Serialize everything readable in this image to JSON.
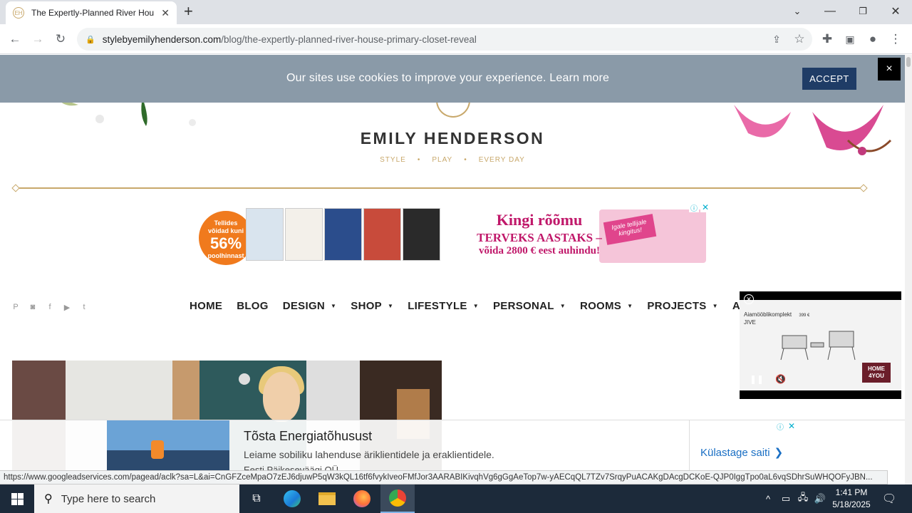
{
  "browser": {
    "tab_title": "The Expertly-Planned River Hou",
    "tab_favicon_icon": "emily-henderson-monogram-icon",
    "url_domain": "stylebyemilyhenderson.com",
    "url_path": "/blog/the-expertly-planned-river-house-primary-closet-reveal",
    "status_url": "https://www.googleadservices.com/pagead/aclk?sa=L&ai=CnGFZceMpaO7zEJ6djuwP5qW3kQL16tf6fvykIveoFMfJor3AARABIKivqhVg6gGgAeTop7w-yAECqQL7TZv7SrqyPuACAKgDAcgDCKoE-QJP0IggTpo0aL6vqSDhrSuWHQOFyJBN..."
  },
  "cookie_banner": {
    "message": "Our sites use cookies to improve your experience. Learn more",
    "accept_label": "ACCEPT",
    "close_label": "×"
  },
  "site": {
    "brand": "EMILY HENDERSON",
    "tagline": [
      "STYLE",
      "•",
      "PLAY",
      "•",
      "EVERY DAY"
    ],
    "social_icons": [
      "pinterest-icon",
      "instagram-icon",
      "facebook-icon",
      "youtube-icon",
      "twitter-icon"
    ],
    "nav": [
      {
        "label": "HOME",
        "caret": false
      },
      {
        "label": "BLOG",
        "caret": false
      },
      {
        "label": "DESIGN",
        "caret": true
      },
      {
        "label": "SHOP",
        "caret": true
      },
      {
        "label": "LIFESTYLE",
        "caret": true
      },
      {
        "label": "PERSONAL",
        "caret": true
      },
      {
        "label": "ROOMS",
        "caret": true
      },
      {
        "label": "PROJECTS",
        "caret": true
      },
      {
        "label": "ABOUT",
        "caret": false
      }
    ]
  },
  "top_ad": {
    "badge_line1": "Tellides",
    "badge_line2": "võidad kuni",
    "badge_big": "56%",
    "badge_line3": "poolhinnast",
    "headline": "Kingi rõõmu",
    "sub1": "TERVEKS AASTAKS –",
    "sub2": "võida 2800 € eest auhindu!",
    "gift_tag": "Igale tellijale kingitus!"
  },
  "video_ad": {
    "brand": "Aiamööblikomplekt",
    "brand2": "JIVE",
    "price": "399 €",
    "logo": "HOME 4YOU"
  },
  "bottom_ad": {
    "headline": "Tõsta Energiatõhusust",
    "description": "Leiame sobiliku lahenduse äriklientidele ja eraklientidele.",
    "company": "Eesti Päikeseväägi OÜ",
    "cta": "Külastage saiti"
  },
  "taskbar": {
    "search_placeholder": "Type here to search",
    "time": "1:41 PM",
    "date": "5/18/2025"
  },
  "colors": {
    "gold": "#c8a86b",
    "cookie_bg": "#8a9aa8",
    "accept_bg": "#1f3c66",
    "ad_magenta": "#c0186a"
  }
}
